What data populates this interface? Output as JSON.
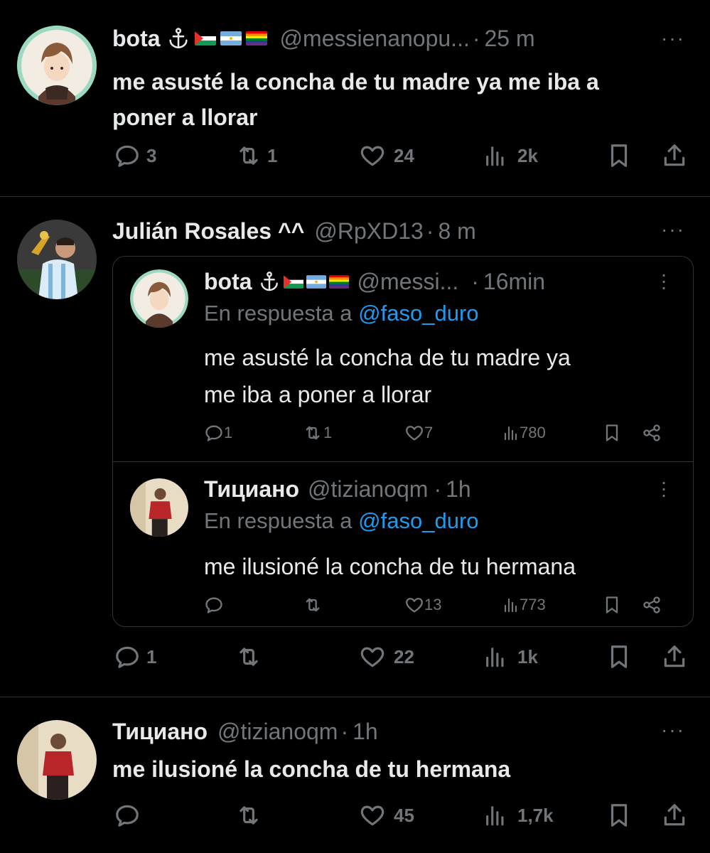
{
  "tweets": [
    {
      "name": "bota",
      "handle": "@messienanopu...",
      "dot": "·",
      "time": "25 m",
      "more": "···",
      "text_line1": "me asusté la concha de tu madre ya me iba a",
      "text_line2": "poner a llorar",
      "replies": "3",
      "retweets": "1",
      "likes": "24",
      "views": "2k"
    },
    {
      "name": "Julián Rosales ^^",
      "handle": "@RpXD13",
      "dot": "·",
      "time": "8 m",
      "more": "···",
      "replies": "1",
      "retweets": "",
      "likes": "22",
      "views": "1k"
    },
    {
      "name": "Тициано",
      "handle": "@tizianoqm",
      "dot": "·",
      "time": "1h",
      "more": "···",
      "text_line1": "me ilusioné la concha de tu hermana",
      "replies": "",
      "retweets": "",
      "likes": "45",
      "views": "1,7k"
    }
  ],
  "quoted": [
    {
      "name": "bota",
      "handle": "@messi...",
      "dot": "·",
      "time": "16min",
      "reply_prefix": "En respuesta a",
      "reply_to": "@faso_duro",
      "text_line1": "me asusté la concha de tu madre ya",
      "text_line2": "me iba a poner a llorar",
      "replies": "1",
      "retweets": "1",
      "likes": "7",
      "views": "780"
    },
    {
      "name": "Тициано",
      "handle": "@tizianoqm",
      "dot": "·",
      "time": "1h",
      "reply_prefix": "En respuesta a",
      "reply_to": "@faso_duro",
      "text_line1": "me ilusioné la concha de tu hermana",
      "replies": "",
      "retweets": "",
      "likes": "13",
      "views": "773"
    }
  ],
  "icons": {
    "reply": "reply-icon",
    "retweet": "retweet-icon",
    "like": "heart-icon",
    "views": "views-icon",
    "bookmark": "bookmark-icon",
    "share": "share-icon",
    "anchor": "anchor-icon",
    "flags": [
      "palestine-flag",
      "argentina-flag",
      "rainbow-flag"
    ]
  },
  "colors": {
    "background": "#000000",
    "text": "#e7e9ea",
    "muted": "#71767b",
    "link": "#1d9bf0",
    "border": "#2f3336"
  }
}
